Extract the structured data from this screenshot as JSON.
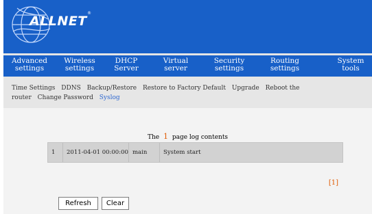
{
  "brand": {
    "logo_text": "ALLNET",
    "logo_tm": "®"
  },
  "colors": {
    "header_blue": "#1860c8",
    "subnav_bg": "#e6e6e6",
    "accent_orange": "#e05a00",
    "link_blue": "#2d67d0"
  },
  "mainnav": {
    "items": [
      {
        "line1": "Advanced",
        "line2": "settings"
      },
      {
        "line1": "Wireless",
        "line2": "settings"
      },
      {
        "line1": "DHCP",
        "line2": "Server"
      },
      {
        "line1": "Virtual",
        "line2": "server"
      },
      {
        "line1": "Security",
        "line2": "settings"
      },
      {
        "line1": "Routing",
        "line2": "settings"
      },
      {
        "line1": "System",
        "line2": "tools"
      }
    ],
    "active_index": 6
  },
  "subnav": {
    "line1": [
      "Time Settings",
      "DDNS",
      "Backup/Restore",
      "Restore to Factory Default",
      "Upgrade",
      "Reboot the"
    ],
    "line2": [
      "router",
      "Change Password",
      "Syslog"
    ],
    "selected": "Syslog"
  },
  "log": {
    "title_before": "The",
    "page_number": "1",
    "title_after": "page log contents",
    "rows": [
      {
        "index": "1",
        "time": "2011-04-01 00:00:00",
        "source": "main",
        "message": "System start"
      }
    ],
    "page_link": "[1]"
  },
  "buttons": {
    "refresh": "Refresh",
    "clear": "Clear"
  }
}
